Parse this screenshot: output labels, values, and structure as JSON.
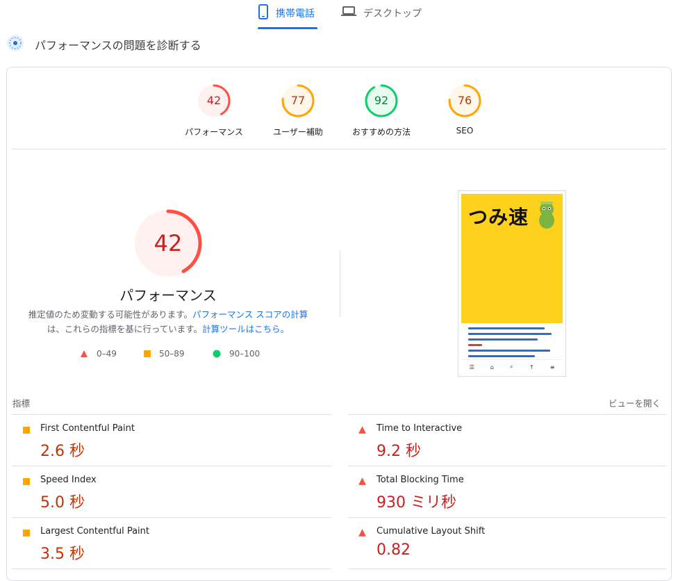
{
  "tabs": {
    "mobile": "携帯電話",
    "desktop": "デスクトップ"
  },
  "diagnose_title": "パフォーマンスの問題を診断する",
  "scores": [
    {
      "label": "パフォーマンス",
      "value": "42",
      "fraction": 0.42,
      "status": "fail"
    },
    {
      "label": "ユーザー補助",
      "value": "77",
      "fraction": 0.77,
      "status": "average"
    },
    {
      "label": "おすすめの方法",
      "value": "92",
      "fraction": 0.92,
      "status": "pass"
    },
    {
      "label": "SEO",
      "value": "76",
      "fraction": 0.76,
      "status": "average"
    }
  ],
  "main_score": {
    "value": "42",
    "fraction": 0.42,
    "title": "パフォーマンス"
  },
  "description": {
    "text1": "推定値のため変動する可能性があります。",
    "link1": "パフォーマンス スコアの計算",
    "text2": "は、これらの指標を基に行っています。",
    "link2": "計算ツールはこちら。"
  },
  "legend": {
    "fail": "0–49",
    "average": "50–89",
    "pass": "90–100"
  },
  "thumbnail": {
    "logo": "つみ速"
  },
  "metrics_header": {
    "label": "指標",
    "expand": "ビューを開く"
  },
  "metrics": [
    {
      "name": "First Contentful Paint",
      "value": "2.6 秒",
      "status": "average"
    },
    {
      "name": "Time to Interactive",
      "value": "9.2 秒",
      "status": "fail"
    },
    {
      "name": "Speed Index",
      "value": "5.0 秒",
      "status": "average"
    },
    {
      "name": "Total Blocking Time",
      "value": "930 ミリ秒",
      "status": "fail"
    },
    {
      "name": "Largest Contentful Paint",
      "value": "3.5 秒",
      "status": "average"
    },
    {
      "name": "Cumulative Layout Shift",
      "value": "0.82",
      "status": "fail"
    }
  ],
  "colors": {
    "fail": "#ff4e42",
    "average": "#ffa400",
    "pass": "#0cce6b",
    "accent": "#1a73e8"
  }
}
